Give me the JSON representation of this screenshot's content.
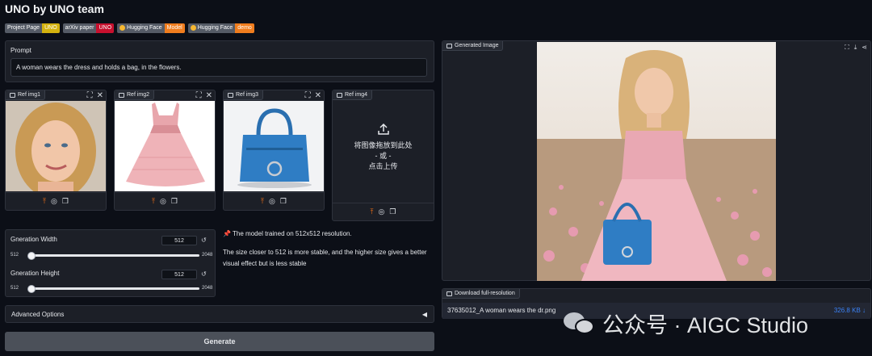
{
  "app": {
    "title": "UNO by UNO team"
  },
  "badges": [
    {
      "left": "Project Page",
      "right": "UNO",
      "color": "#d4b20f"
    },
    {
      "left": "arXiv paper",
      "right": "UNO",
      "color": "#c8102e"
    },
    {
      "left": "Hugging Face",
      "right": "Model",
      "color": "#f07d1e"
    },
    {
      "left": "Hugging Face",
      "right": "demo",
      "color": "#f07d1e"
    }
  ],
  "prompt": {
    "label": "Prompt",
    "value": "A woman wears the dress and holds a bag, in the flowers."
  },
  "refs": [
    {
      "label": "Ref img1"
    },
    {
      "label": "Ref img2"
    },
    {
      "label": "Ref img3"
    },
    {
      "label": "Ref img4",
      "upload_line1": "将图像拖放到此处",
      "upload_line2": "- 或 -",
      "upload_line3": "点击上传"
    }
  ],
  "width_slider": {
    "label": "Gneration Width",
    "value": "512",
    "min": "512",
    "max": "2048",
    "level": 0
  },
  "height_slider": {
    "label": "Gneration Height",
    "value": "512",
    "min": "512",
    "max": "2048",
    "level": 0
  },
  "notes": {
    "line1": "The model trained on 512x512 resolution.",
    "line2": "The size closer to 512 is more stable, and the higher size gives a better visual effect but is less stable"
  },
  "advanced": {
    "label": "Advanced Options"
  },
  "generate": {
    "label": "Generate"
  },
  "output": {
    "label": "Generated Image"
  },
  "download": {
    "label": "Download full-resolution",
    "filename": "37635012_A woman wears the dr.png",
    "size": "326.8 KB ↓"
  },
  "watermark": {
    "text": "公众号 · AIGC Studio"
  },
  "icons": {
    "pin": "📌",
    "upload": "upload-icon",
    "fullscreen": "fullscreen-icon",
    "close": "close-icon"
  }
}
